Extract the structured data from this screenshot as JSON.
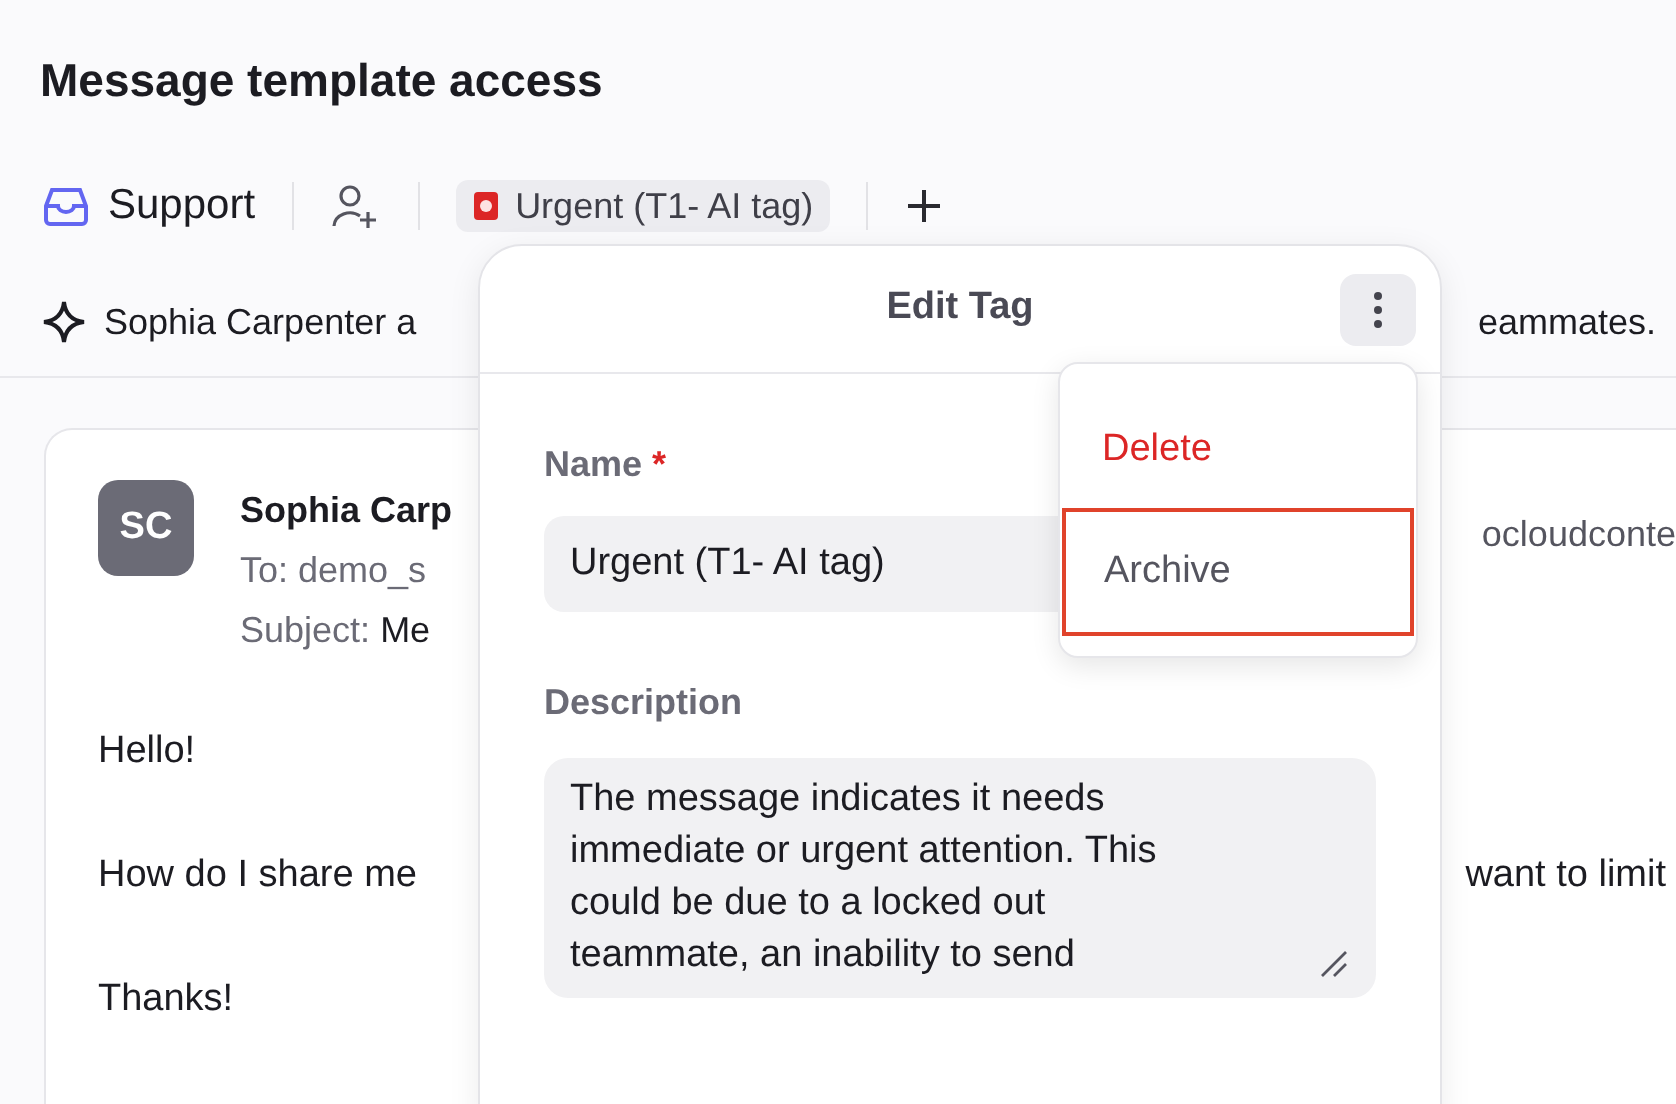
{
  "page": {
    "title": "Message template access"
  },
  "toolbar": {
    "inbox": "Support",
    "tag": "Urgent (T1- AI tag)"
  },
  "summary": {
    "left": "Sophia Carpenter a",
    "right": "eammates."
  },
  "message": {
    "avatar": "SC",
    "sender": "Sophia Carp",
    "sender_right": "ocloudconte",
    "to": "To: demo_s",
    "subject_label": "Subject:",
    "subject": "Me",
    "body": [
      {
        "left": "Hello!"
      },
      {
        "left": "How do I share me",
        "right": "want to limit"
      },
      {
        "left": "Thanks!"
      }
    ]
  },
  "dialog": {
    "title": "Edit Tag",
    "name_label": "Name",
    "required_mark": "*",
    "name_value": "Urgent (T1- AI tag)",
    "description_label": "Description",
    "description_value": "The message indicates it needs immediate or urgent attention. This could be due to a locked out teammate, an inability to send"
  },
  "menu": {
    "items": [
      {
        "label": "Delete",
        "kind": "danger",
        "highlighted": false
      },
      {
        "label": "Archive",
        "kind": "normal",
        "highlighted": true
      }
    ]
  }
}
